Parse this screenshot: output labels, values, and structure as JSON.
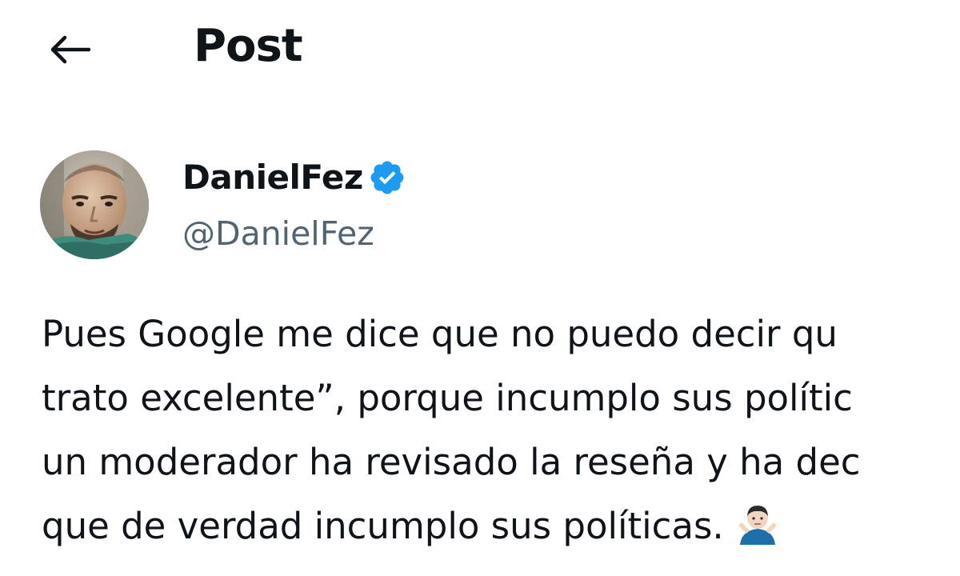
{
  "header": {
    "title": "Post",
    "back_icon": "arrow-left-icon"
  },
  "author": {
    "display_name": "DanielFez",
    "handle": "@DanielFez",
    "verified_icon": "verified-badge-icon",
    "verified_color": "#1d9bf0"
  },
  "post": {
    "lines": [
      "Pues Google me dice que no puedo decir qu",
      "trato excelente”, porque incumplo sus polític",
      "un moderador ha revisado la reseña y ha dec",
      "que de verdad incumplo sus políticas."
    ],
    "emoji": "man-shrugging-emoji"
  },
  "colors": {
    "text_primary": "#0f1419",
    "text_secondary": "#536471",
    "accent": "#1d9bf0"
  }
}
